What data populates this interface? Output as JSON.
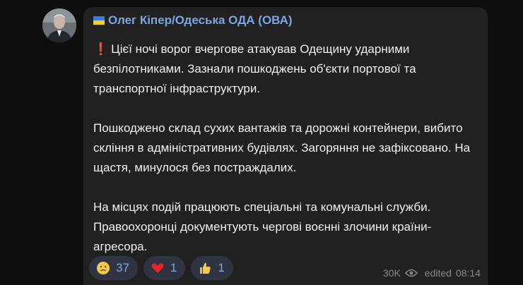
{
  "message": {
    "sender": "Олег Кіпер/Одеська ОДА (ОВА)",
    "paragraphs": [
      "Цієї ночі ворог вчергове атакував Одещину ударними безпілотниками. Зазнали пошкоджень об'єкти портової та транспортної інфраструктури.",
      "Пошкоджено склад сухих вантажів та дорожні контейнери, вибито скління в адміністративних будівлях. Загоряння не зафіксовано. На щастя, минулося без постраждалих.",
      "На місцях подій працюють спеціальні та комунальні служби. Правоохоронці документують чергові воєнні злочини країни-агресора."
    ],
    "reactions": [
      {
        "icon": "sad-face-icon",
        "count": "37"
      },
      {
        "icon": "red-heart-icon",
        "count": "1"
      },
      {
        "icon": "thumbs-up-icon",
        "count": "1"
      }
    ],
    "views": "30K",
    "edited_label": "edited",
    "time": "08:14"
  },
  "colors": {
    "bubble": "#212121",
    "sender": "#7aa6e6",
    "reaction_bg": "#2f3440",
    "reaction_count": "#7ba6e8"
  }
}
